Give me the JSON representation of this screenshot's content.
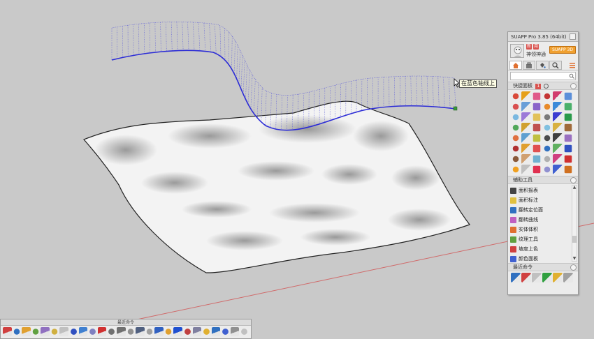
{
  "viewport": {
    "tooltip": "在蓝色轴线上",
    "colors": {
      "curve": "#2b2bd6",
      "surface_edge": "#222222",
      "red_axis": "#d06a6a",
      "background": "#c9c9c9"
    }
  },
  "suapp_panel": {
    "title": "SUAPP Pro 3.85 (64bit)",
    "user": {
      "badges": [
        "新",
        "用"
      ],
      "name": "神领神通",
      "signup_label": "SUAPP 3D"
    },
    "tabs": [
      {
        "name": "home-icon",
        "active": true
      },
      {
        "name": "toolbox-icon",
        "active": false
      },
      {
        "name": "paint-bucket-icon",
        "active": false
      },
      {
        "name": "search-icon",
        "active": false
      }
    ],
    "quick_panel": {
      "label": "快捷面板",
      "badge": "1"
    },
    "icon_grid_colors": [
      "#d94a3a",
      "#e6a019",
      "#e05a8a",
      "#c43535",
      "#d13b6d",
      "#5b8fd9",
      "#d95050",
      "#6a9fd8",
      "#8a63c9",
      "#e88a2a",
      "#3a8ad9",
      "#4ab06a",
      "#7ab8e0",
      "#9c7ad8",
      "#e2c25a",
      "#7a7a7a",
      "#3c3cd0",
      "#2a9a4a",
      "#52a85a",
      "#d0a030",
      "#c05050",
      "#80c0e0",
      "#d8b040",
      "#a06a3a",
      "#e07040",
      "#60a0d0",
      "#c0c040",
      "#4a4a4a",
      "#404040",
      "#9a70c0",
      "#b03030",
      "#e0a030",
      "#e05050",
      "#3070c0",
      "#60b060",
      "#3050c0",
      "#8a5a3a",
      "#d0a070",
      "#70b0d0",
      "#b0b0b0",
      "#d04080",
      "#d03030",
      "#f0a020",
      "#c0c0c0",
      "#e03050",
      "#9090d0",
      "#4060d0",
      "#d07020"
    ],
    "aux_tools": {
      "label": "辅助工具",
      "items": [
        {
          "label": "面积报表",
          "color": "#444444"
        },
        {
          "label": "面积标注",
          "color": "#e0c040"
        },
        {
          "label": "翻转定位面",
          "color": "#3070c0"
        },
        {
          "label": "翻转曲线",
          "color": "#c060c0"
        },
        {
          "label": "实体体积",
          "color": "#e07030"
        },
        {
          "label": "纹理工具",
          "color": "#60a040"
        },
        {
          "label": "坡度上色",
          "color": "#d04040"
        },
        {
          "label": "颜色面板",
          "color": "#4060d0"
        },
        {
          "label": "海拔上色",
          "color": "#e05030"
        }
      ]
    },
    "recent": {
      "label": "最近命令",
      "icon_colors": [
        "#3070c0",
        "#d04040",
        "#c0c0c0",
        "#30a040",
        "#e0b030",
        "#a0a0a0"
      ]
    }
  },
  "bottom_toolbar": {
    "title": "最近命令",
    "icon_colors": [
      "#d04040",
      "#3070c0",
      "#e0a030",
      "#60a040",
      "#9070c0",
      "#d0b040",
      "#c0c0c0",
      "#3050c0",
      "#4080d0",
      "#8080c0",
      "#d03030",
      "#707070",
      "#707070",
      "#909090",
      "#506080",
      "#a0a0a0",
      "#3060c0",
      "#e0a030",
      "#2050d0",
      "#c04040",
      "#8080a0",
      "#e0b030",
      "#3070c0",
      "#4060d0",
      "#909090",
      "#c0c0c0"
    ]
  }
}
